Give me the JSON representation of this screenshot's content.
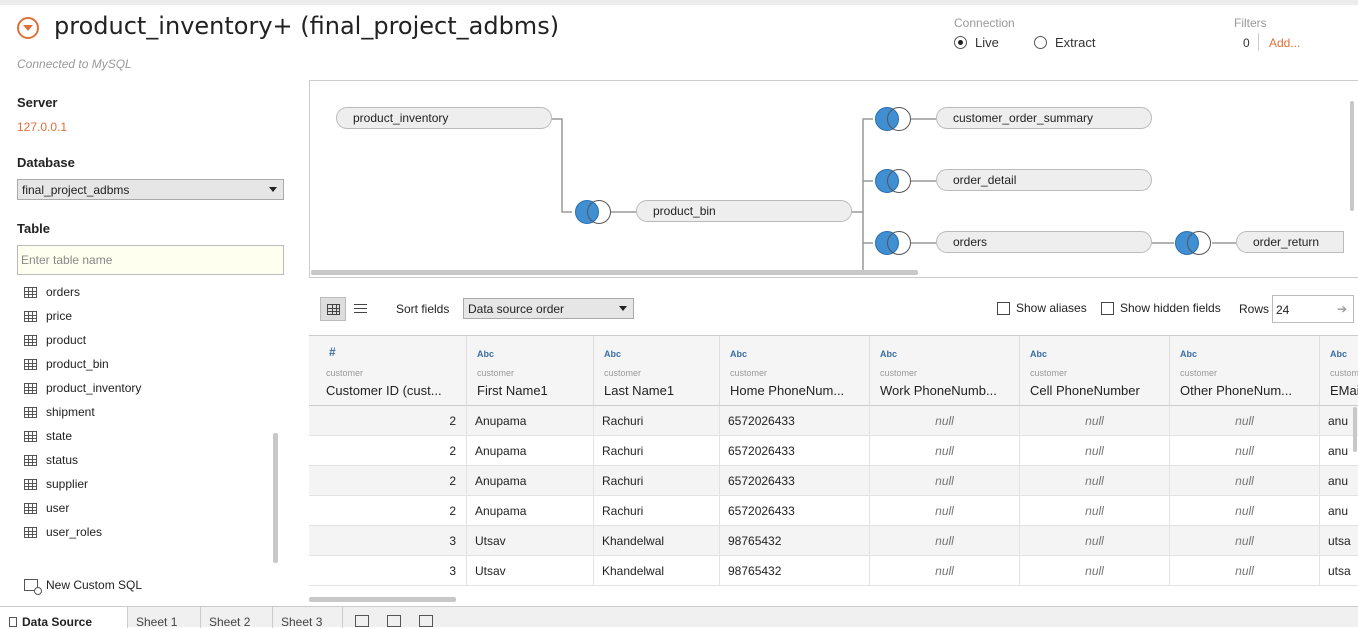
{
  "header": {
    "title": "product_inventory+ (final_project_adbms)",
    "connected": "Connected to MySQL"
  },
  "connection": {
    "label": "Connection",
    "options": [
      {
        "label": "Live",
        "selected": true
      },
      {
        "label": "Extract",
        "selected": false
      }
    ]
  },
  "filters": {
    "label": "Filters",
    "count": "0",
    "add": "Add..."
  },
  "sidebar": {
    "server_label": "Server",
    "server_value": "127.0.0.1",
    "database_label": "Database",
    "database_value": "final_project_adbms",
    "table_label": "Table",
    "table_placeholder": "Enter table name",
    "tables": [
      "orders",
      "price",
      "product",
      "product_bin",
      "product_inventory",
      "shipment",
      "state",
      "status",
      "supplier",
      "user",
      "user_roles"
    ],
    "custom_sql": "New Custom SQL"
  },
  "canvas": {
    "tables": [
      "product_inventory",
      "product_bin",
      "customer_order_summary",
      "order_detail",
      "orders",
      "order_return"
    ]
  },
  "toolbar": {
    "sort_label": "Sort fields",
    "sort_value": "Data source order",
    "show_aliases": "Show aliases",
    "show_hidden": "Show hidden fields",
    "rows_label": "Rows",
    "rows_value": "24"
  },
  "grid": {
    "columns": [
      {
        "type": "#",
        "source": "customer",
        "name": "Customer ID (cust..."
      },
      {
        "type": "Abc",
        "source": "customer",
        "name": "First Name1"
      },
      {
        "type": "Abc",
        "source": "customer",
        "name": "Last Name1"
      },
      {
        "type": "Abc",
        "source": "customer",
        "name": "Home PhoneNum..."
      },
      {
        "type": "Abc",
        "source": "customer",
        "name": "Work PhoneNumb..."
      },
      {
        "type": "Abc",
        "source": "customer",
        "name": "Cell PhoneNumber"
      },
      {
        "type": "Abc",
        "source": "customer",
        "name": "Other PhoneNum..."
      },
      {
        "type": "Abc",
        "source": "customer",
        "name": "EMai"
      }
    ],
    "rows": [
      [
        "2",
        "Anupama",
        "Rachuri",
        "6572026433",
        "null",
        "null",
        "null",
        "anu"
      ],
      [
        "2",
        "Anupama",
        "Rachuri",
        "6572026433",
        "null",
        "null",
        "null",
        "anu"
      ],
      [
        "2",
        "Anupama",
        "Rachuri",
        "6572026433",
        "null",
        "null",
        "null",
        "anu"
      ],
      [
        "2",
        "Anupama",
        "Rachuri",
        "6572026433",
        "null",
        "null",
        "null",
        "anu"
      ],
      [
        "3",
        "Utsav",
        "Khandelwal",
        "98765432",
        "null",
        "null",
        "null",
        "utsa"
      ],
      [
        "3",
        "Utsav",
        "Khandelwal",
        "98765432",
        "null",
        "null",
        "null",
        "utsa"
      ]
    ]
  },
  "tabs": [
    "Data Source",
    "Sheet 1",
    "Sheet 2",
    "Sheet 3"
  ]
}
